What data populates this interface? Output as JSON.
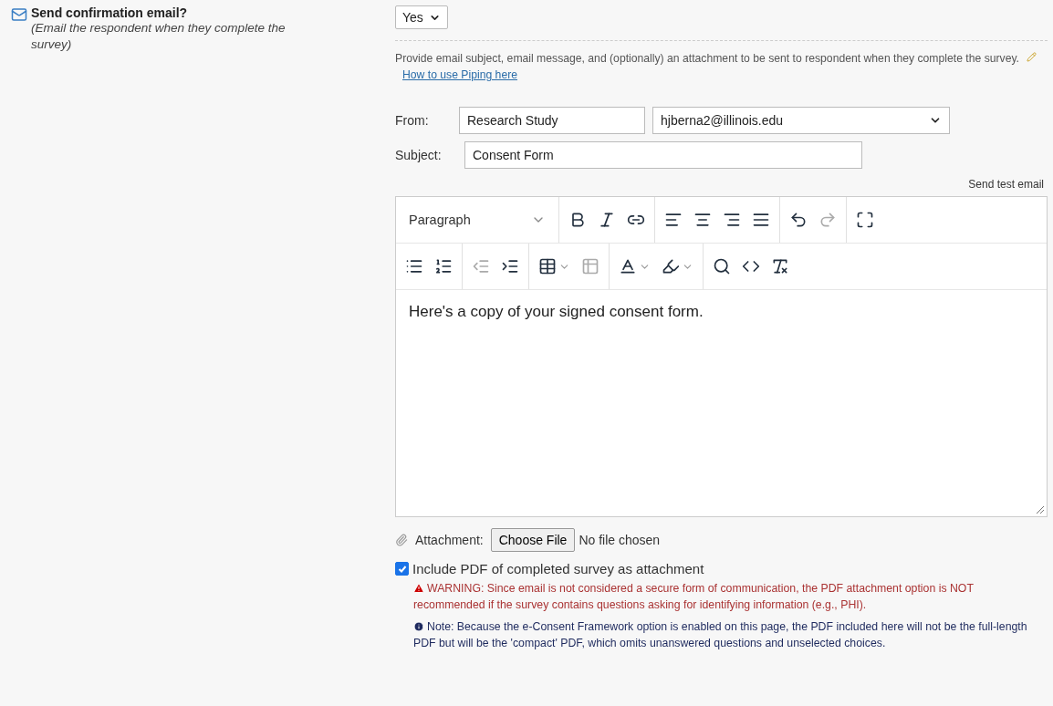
{
  "question": {
    "title": "Send confirmation email?",
    "hint": "(Email the respondent when they complete the survey)"
  },
  "enable_select": {
    "value": "Yes"
  },
  "instructions": {
    "text": "Provide email subject, email message, and (optionally) an attachment to be sent to respondent when they complete the survey.",
    "link": "How to use Piping here"
  },
  "from": {
    "label": "From:",
    "name": "Research Study",
    "email": "hjberna2@illinois.edu"
  },
  "subject": {
    "label": "Subject:",
    "value": "Consent Form"
  },
  "send_test": "Send test email",
  "editor": {
    "block_format": "Paragraph",
    "toolbar_rows": [
      [
        [
          {
            "kind": "bold",
            "disabled": false
          },
          {
            "kind": "italic",
            "disabled": false
          },
          {
            "kind": "link",
            "disabled": false
          }
        ],
        [
          {
            "kind": "align-left",
            "disabled": false
          },
          {
            "kind": "align-center",
            "disabled": false
          },
          {
            "kind": "align-right",
            "disabled": false
          },
          {
            "kind": "justify",
            "disabled": false
          }
        ],
        [
          {
            "kind": "undo",
            "disabled": false
          },
          {
            "kind": "redo",
            "disabled": true
          }
        ],
        [
          {
            "kind": "fullscreen",
            "disabled": false
          }
        ]
      ],
      [
        [
          {
            "kind": "bullet-list",
            "disabled": false
          },
          {
            "kind": "numbered-list",
            "disabled": false
          }
        ],
        [
          {
            "kind": "outdent",
            "disabled": true
          },
          {
            "kind": "indent",
            "disabled": false
          }
        ],
        [
          {
            "kind": "table",
            "disabled": false
          },
          {
            "kind": "table-props",
            "disabled": true
          }
        ],
        [
          {
            "kind": "text-color",
            "disabled": false
          },
          {
            "kind": "highlight",
            "disabled": false
          }
        ],
        [
          {
            "kind": "search",
            "disabled": false
          },
          {
            "kind": "code",
            "disabled": false
          },
          {
            "kind": "clear-format",
            "disabled": false
          }
        ]
      ]
    ],
    "body": "Here's a copy of your signed consent form."
  },
  "attachment": {
    "label": "Attachment:",
    "button": "Choose File",
    "status": "No file chosen"
  },
  "include_pdf": {
    "checked": true,
    "label": "Include PDF of completed survey as attachment"
  },
  "warning": "WARNING: Since email is not considered a secure form of communication, the PDF attachment option is NOT recommended if the survey contains questions asking for identifying information (e.g., PHI).",
  "note": "Note: Because the e-Consent Framework option is enabled on this page, the PDF included here will not be the full-length PDF but will be the 'compact' PDF, which omits unanswered questions and unselected choices."
}
